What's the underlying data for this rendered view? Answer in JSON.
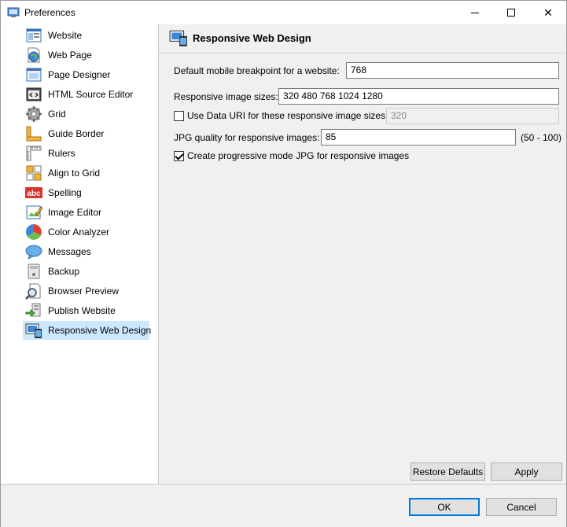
{
  "window": {
    "title": "Preferences",
    "controls": {
      "minimize": "—",
      "maximize": "□",
      "close": "✕"
    }
  },
  "sidebar": {
    "items": [
      {
        "label": "Website",
        "icon": "website-icon"
      },
      {
        "label": "Web Page",
        "icon": "web-page-icon"
      },
      {
        "label": "Page Designer",
        "icon": "page-designer-icon"
      },
      {
        "label": "HTML Source Editor",
        "icon": "html-source-icon"
      },
      {
        "label": "Grid",
        "icon": "grid-icon"
      },
      {
        "label": "Guide Border",
        "icon": "guide-border-icon"
      },
      {
        "label": "Rulers",
        "icon": "rulers-icon"
      },
      {
        "label": "Align to Grid",
        "icon": "align-grid-icon"
      },
      {
        "label": "Spelling",
        "icon": "spelling-icon"
      },
      {
        "label": "Image Editor",
        "icon": "image-editor-icon"
      },
      {
        "label": "Color Analyzer",
        "icon": "color-analyzer-icon"
      },
      {
        "label": "Messages",
        "icon": "messages-icon"
      },
      {
        "label": "Backup",
        "icon": "backup-icon"
      },
      {
        "label": "Browser Preview",
        "icon": "browser-preview-icon"
      },
      {
        "label": "Publish Website",
        "icon": "publish-website-icon"
      },
      {
        "label": "Responsive Web Design",
        "icon": "responsive-design-icon",
        "selected": true
      }
    ],
    "abc_text": "abc"
  },
  "panel": {
    "title": "Responsive Web Design",
    "breakpoint_label": "Default mobile breakpoint for a website:",
    "breakpoint_value": "768",
    "sizes_label": "Responsive image sizes:",
    "sizes_value": "320 480 768 1024 1280",
    "data_uri_label": "Use Data URI for these responsive image sizes:",
    "data_uri_checked": false,
    "data_uri_value": "320",
    "jpg_quality_label": "JPG quality for responsive images:",
    "jpg_quality_value": "85",
    "jpg_quality_range": "(50 - 100)",
    "progressive_label": "Create progressive mode JPG for responsive images",
    "progressive_checked": true,
    "restore_label": "Restore Defaults",
    "apply_label": "Apply"
  },
  "footer": {
    "ok_label": "OK",
    "cancel_label": "Cancel"
  },
  "colors": {
    "selection": "#cce8ff",
    "accent": "#0078d7"
  }
}
